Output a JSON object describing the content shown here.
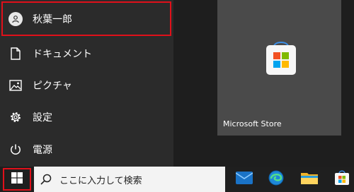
{
  "start_menu": {
    "user": {
      "label": "秋葉一郎",
      "icon": "user-avatar-icon"
    },
    "items": [
      {
        "label": "ドキュメント",
        "icon": "document-icon"
      },
      {
        "label": "ピクチャ",
        "icon": "picture-icon"
      },
      {
        "label": "設定",
        "icon": "gear-icon"
      },
      {
        "label": "電源",
        "icon": "power-icon"
      }
    ],
    "tiles": [
      {
        "label": "Microsoft Store",
        "icon": "microsoft-store-icon"
      }
    ]
  },
  "taskbar": {
    "start_icon": "windows-logo-icon",
    "search_placeholder": "ここに入力して検索",
    "apps": [
      {
        "name": "mail-icon"
      },
      {
        "name": "edge-icon"
      },
      {
        "name": "file-explorer-icon"
      },
      {
        "name": "store-icon"
      }
    ]
  },
  "colors": {
    "highlight_border": "#e0101a",
    "left_panel": "#2b2b2b",
    "tile_bg": "#4a4a4a",
    "taskbar": "#1f1f1f",
    "search_bg": "#f3f3f3"
  }
}
